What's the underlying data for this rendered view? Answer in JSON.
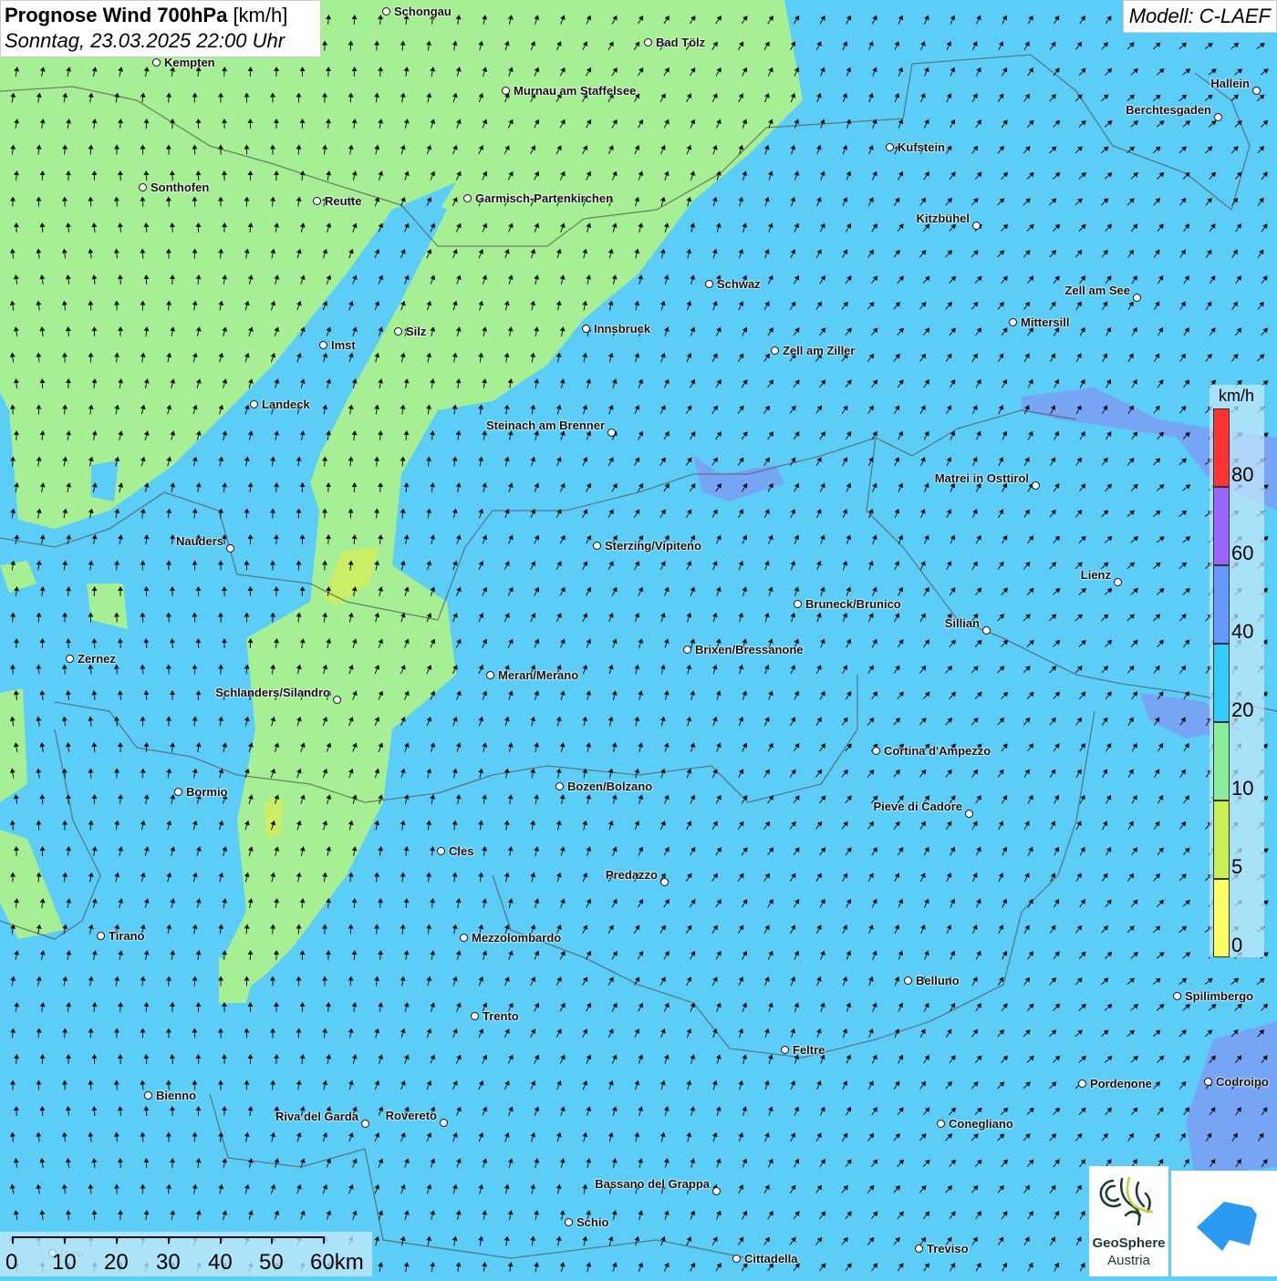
{
  "header": {
    "title_bold": "Prognose Wind 700hPa",
    "title_unit": "[km/h]",
    "subtitle": "Sonntag, 23.03.2025 22:00 Uhr",
    "model": "Modell: C-LAEF"
  },
  "legend": {
    "unit": "km/h",
    "ticks": [
      "0",
      "5",
      "10",
      "20",
      "40",
      "60",
      "80"
    ],
    "bins": [
      {
        "range": "0-5",
        "color": "#ffff66"
      },
      {
        "range": "5-10",
        "color": "#ccee55"
      },
      {
        "range": "10-20",
        "color": "#88ee99"
      },
      {
        "range": "20-40",
        "color": "#33ccff"
      },
      {
        "range": "40-60",
        "color": "#6699ff"
      },
      {
        "range": "60-80",
        "color": "#9966ff"
      },
      {
        "range": "80+",
        "color": "#ff3333"
      }
    ]
  },
  "scale_bar": {
    "labels": [
      "0",
      "10",
      "20",
      "30",
      "40",
      "50",
      "60km"
    ]
  },
  "logos": {
    "geosphere_line1": "GeoSphere",
    "geosphere_line2": "Austria"
  },
  "cities": [
    "Schongau",
    "Bad Tölz",
    "Kempten",
    "Murnau am Staffelsee",
    "Hallein",
    "Berchtesgaden",
    "Kufstein",
    "Sonthofen",
    "Reutte",
    "Garmisch-Partenkirchen",
    "Kitzbühel",
    "Schwaz",
    "Zell am See",
    "Mittersill",
    "Innsbruck",
    "Zell am Ziller",
    "Imst",
    "Silz",
    "Landeck",
    "Steinach am Brenner",
    "Matrei in Osttirol",
    "Nauders",
    "Sterzing/Vipiteno",
    "Lienz",
    "Bruneck/Brunico",
    "Sillian",
    "Brixen/Bressanone",
    "Zernez",
    "Meran/Merano",
    "Schlanders/Silandro",
    "Cortina d'Ampezzo",
    "Bozen/Bolzano",
    "Bormio",
    "Pieve di Cadore",
    "Cles",
    "Predazzo",
    "Tirano",
    "Mezzolombardo",
    "Belluno",
    "Spilimbergo",
    "Trento",
    "Feltre",
    "Bienno",
    "Pordenone",
    "Codroipo",
    "Riva del Garda",
    "Rovereto",
    "Conegliano",
    "Bassano del Grappa",
    "Schio",
    "Treviso",
    "Cittadella",
    "Iseo"
  ]
}
